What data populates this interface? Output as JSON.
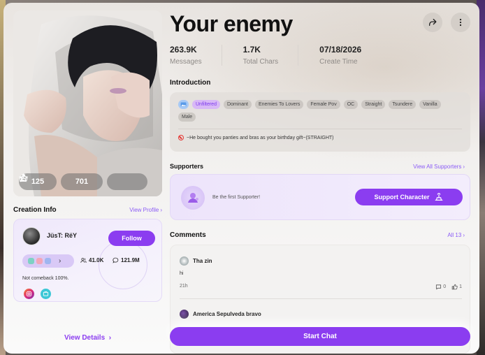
{
  "character": {
    "name": "Your enemy",
    "likes": "125",
    "favorites": "701"
  },
  "stats": [
    {
      "value": "263.9K",
      "label": "Messages"
    },
    {
      "value": "1.7K",
      "label": "Total Chars"
    },
    {
      "value": "07/18/2026",
      "label": "Create Time"
    }
  ],
  "creation": {
    "title": "Creation Info",
    "view_profile": "View Profile",
    "creator_name": "JüsT: RëY",
    "follow_label": "Follow",
    "followers": "41.0K",
    "chats": "121.9M",
    "bio": "Not comeback 100%."
  },
  "view_details": "View Details",
  "introduction": {
    "title": "Introduction",
    "tags": [
      "Unfiltered",
      "Dominant",
      "Enemies To Lovers",
      "Female Pov",
      "OC",
      "Straight",
      "Tsundere",
      "Vanilla",
      "Male"
    ],
    "highlight_tag": "Unfiltered",
    "text": "~He bought you panties and bras as your birthday gift~(STRAIGHT)"
  },
  "supporters": {
    "title": "Supporters",
    "view_all": "View All Supporters",
    "empty_text": "Be the first Supporter!",
    "support_label": "Support Character"
  },
  "comments": {
    "title": "Comments",
    "all_label": "All 13",
    "items": [
      {
        "author": "Tha zin",
        "text": "hi",
        "time": "21h",
        "replies": "0",
        "likes": "1"
      },
      {
        "author": "America Sepulveda bravo",
        "text": "",
        "time": "",
        "replies": "",
        "likes": ""
      }
    ]
  },
  "start_chat": "Start Chat",
  "colors": {
    "accent": "#8b3df0",
    "accent_light": "#ede4fb",
    "link": "#8b5cf6"
  },
  "icons": [
    "share-icon",
    "more-icon",
    "thumbs-up-icon",
    "star-icon",
    "gift-icon",
    "users-icon",
    "chat-icon",
    "instagram-icon",
    "tv-icon",
    "comment-icon",
    "chevron-right-icon"
  ]
}
